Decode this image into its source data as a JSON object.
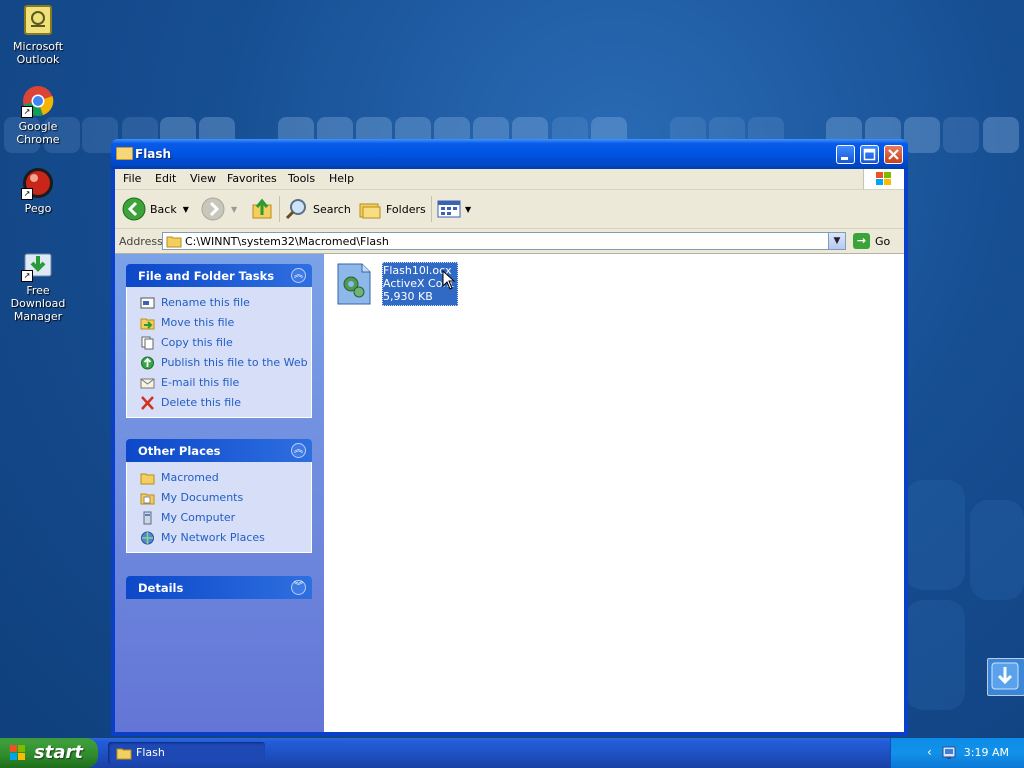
{
  "desktop": {
    "icons": [
      {
        "label": "Microsoft Outlook",
        "icon": "outlook-icon"
      },
      {
        "label": "Google Chrome",
        "icon": "chrome-icon"
      },
      {
        "label": "Pego",
        "icon": "pego-icon"
      },
      {
        "label": "Free Download Manager",
        "icon": "fdm-icon"
      }
    ]
  },
  "window": {
    "title": "Flash",
    "menu": [
      "File",
      "Edit",
      "View",
      "Favorites",
      "Tools",
      "Help"
    ],
    "toolbar": {
      "back": "Back",
      "search": "Search",
      "folders": "Folders"
    },
    "address": {
      "label": "Address",
      "value": "C:\\WINNT\\system32\\Macromed\\Flash",
      "go": "Go"
    },
    "tasks_panel": {
      "title": "File and Folder Tasks",
      "items": [
        {
          "label": "Rename this file",
          "icon": "rename-icon"
        },
        {
          "label": "Move this file",
          "icon": "move-icon"
        },
        {
          "label": "Copy this file",
          "icon": "copy-icon"
        },
        {
          "label": "Publish this file to the Web",
          "icon": "publish-icon"
        },
        {
          "label": "E-mail this file",
          "icon": "email-icon"
        },
        {
          "label": "Delete this file",
          "icon": "delete-icon"
        }
      ]
    },
    "places_panel": {
      "title": "Other Places",
      "items": [
        {
          "label": "Macromed",
          "icon": "folder-icon"
        },
        {
          "label": "My Documents",
          "icon": "my-documents-icon"
        },
        {
          "label": "My Computer",
          "icon": "my-computer-icon"
        },
        {
          "label": "My Network Places",
          "icon": "network-places-icon"
        }
      ]
    },
    "details_panel": {
      "title": "Details"
    },
    "file": {
      "name": "Flash10l.ocx",
      "type": "ActiveX Cont",
      "size": "5,930 KB"
    }
  },
  "taskbar": {
    "start": "start",
    "task_button": "Flash",
    "clock": "3:19 AM"
  }
}
